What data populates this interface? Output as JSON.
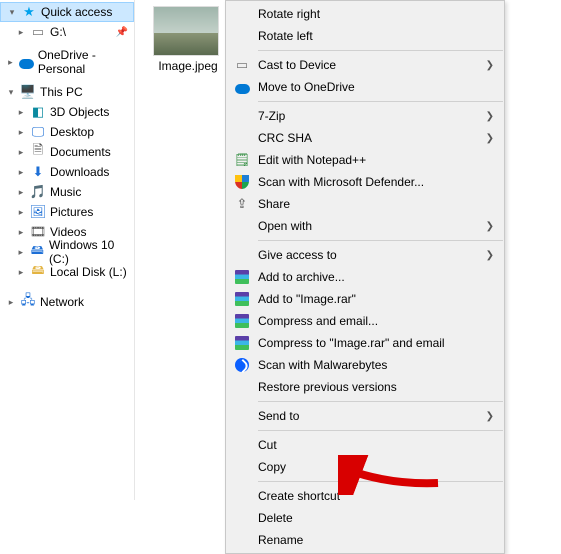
{
  "nav": {
    "quick_access": "Quick access",
    "g_drive": "G:\\",
    "onedrive": "OneDrive - Personal",
    "this_pc": "This PC",
    "objects3d": "3D Objects",
    "desktop": "Desktop",
    "documents": "Documents",
    "downloads": "Downloads",
    "music": "Music",
    "pictures": "Pictures",
    "videos": "Videos",
    "windows10": "Windows 10 (C:)",
    "local_disk_l": "Local Disk (L:)",
    "network": "Network"
  },
  "file": {
    "name": "Image.jpeg"
  },
  "ctx": {
    "rotate_right": "Rotate right",
    "rotate_left": "Rotate left",
    "cast": "Cast to Device",
    "move_onedrive": "Move to OneDrive",
    "seven_zip": "7-Zip",
    "crc_sha": "CRC SHA",
    "notepadpp": "Edit with Notepad++",
    "defender": "Scan with Microsoft Defender...",
    "share": "Share",
    "open_with": "Open with",
    "give_access": "Give access to",
    "add_archive": "Add to archive...",
    "add_image_rar": "Add to \"Image.rar\"",
    "compress_email": "Compress and email...",
    "compress_image_rar_email": "Compress to \"Image.rar\" and email",
    "malwarebytes": "Scan with Malwarebytes",
    "restore_prev": "Restore previous versions",
    "send_to": "Send to",
    "cut": "Cut",
    "copy": "Copy",
    "create_shortcut": "Create shortcut",
    "delete": "Delete",
    "rename": "Rename"
  }
}
